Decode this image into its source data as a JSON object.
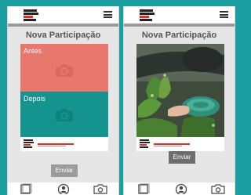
{
  "screens": [
    {
      "title": "Nova Participação",
      "antes_label": "Antes",
      "depois_label": "Depois",
      "send_label": "Enviar",
      "send_enabled": false
    },
    {
      "title": "Nova Participação",
      "send_label": "Enviar",
      "send_enabled": true
    }
  ],
  "icons": [
    "menu-icon",
    "camera-icon",
    "gallery-icon",
    "profile-icon",
    "camera-tab-icon"
  ],
  "colors": {
    "background": "#1a9ea0",
    "antes": "#e8776e",
    "depois": "#14938f",
    "button_disabled": "#9b9b9b",
    "button_enabled": "#6e6e6e"
  }
}
